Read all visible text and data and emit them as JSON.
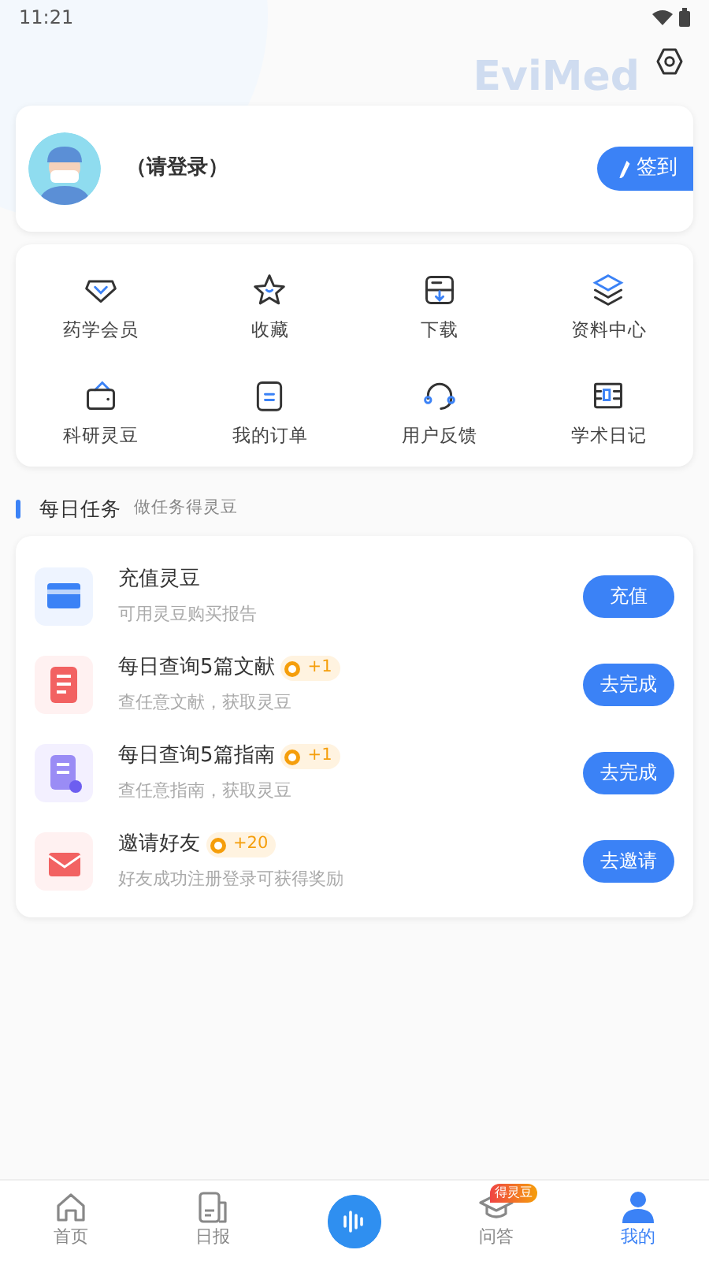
{
  "status_bar": {
    "time": "11:21"
  },
  "brand_watermark": "EviMed",
  "profile": {
    "name": "（请登录）",
    "checkin_button": "签到"
  },
  "shortcuts": [
    {
      "kind": "vip",
      "label": "药学会员"
    },
    {
      "kind": "star",
      "label": "收藏"
    },
    {
      "kind": "download",
      "label": "下载"
    },
    {
      "kind": "layers",
      "label": "资料中心"
    },
    {
      "kind": "wallet",
      "label": "科研灵豆"
    },
    {
      "kind": "order",
      "label": "我的订单"
    },
    {
      "kind": "headset",
      "label": "用户反馈"
    },
    {
      "kind": "diary",
      "label": "学术日记"
    }
  ],
  "daily_tasks": {
    "title": "每日任务",
    "subtitle": "做任务得灵豆",
    "tasks": [
      {
        "kind": "card",
        "title": "充值灵豆",
        "desc": "可用灵豆购买报告",
        "button": "充值"
      },
      {
        "kind": "doc",
        "title": "每日查询5篇文献",
        "reward": "+1",
        "desc": "查任意文献，获取灵豆",
        "button": "去完成"
      },
      {
        "kind": "guide",
        "title": "每日查询5篇指南",
        "reward": "+1",
        "desc": "查任意指南，获取灵豆",
        "button": "去完成"
      },
      {
        "kind": "mail",
        "title": "邀请好友",
        "reward": "+20",
        "desc": "好友成功注册登录可获得奖励",
        "button": "去邀请"
      }
    ]
  },
  "bottom_nav": [
    {
      "kind": "home",
      "label": "首页",
      "selected": false
    },
    {
      "kind": "news",
      "label": "日报",
      "selected": false
    },
    {
      "kind": "voice",
      "selected": false
    },
    {
      "kind": "qa",
      "label": "问答",
      "badge": "得灵豆",
      "selected": false
    },
    {
      "kind": "me",
      "label": "我的",
      "selected": true
    }
  ]
}
